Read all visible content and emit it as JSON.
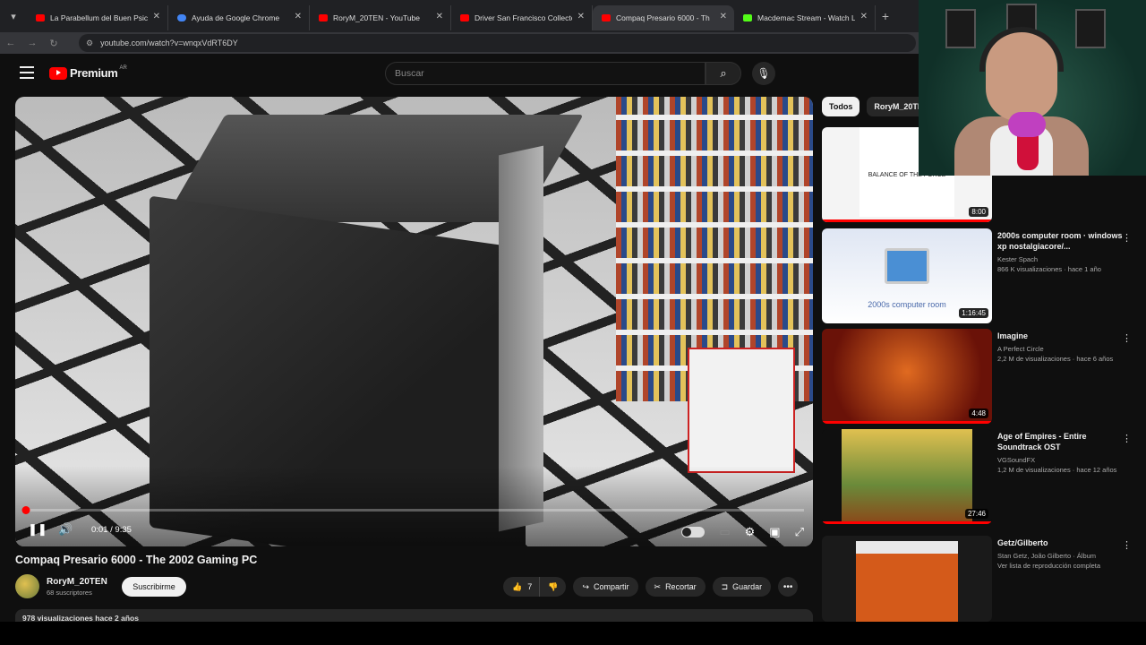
{
  "browser": {
    "tabs": [
      {
        "title": "La Parabellum del Buen Psicóp",
        "favicon_color": "#ff0000",
        "active": false
      },
      {
        "title": "Ayuda de Google Chrome",
        "favicon_color": "#4285f4",
        "active": false
      },
      {
        "title": "RoryM_20TEN - YouTube",
        "favicon_color": "#ff0000",
        "active": false
      },
      {
        "title": "Driver San Francisco Collector",
        "favicon_color": "#ff0000",
        "active": false
      },
      {
        "title": "Compaq Presario 6000 - Th",
        "favicon_color": "#ff0000",
        "active": true
      },
      {
        "title": "Macdemac Stream - Watch Live",
        "favicon_color": "#53fc18",
        "active": false
      }
    ],
    "url": "youtube.com/watch?v=wnqxVdRT6DY"
  },
  "header": {
    "logo_text": "Premium",
    "region": "AR",
    "search_placeholder": "Buscar"
  },
  "player": {
    "time": "0:01 / 9:35",
    "progress_fraction": 0.002
  },
  "video": {
    "title": "Compaq Presario 6000 - The 2002 Gaming PC",
    "channel": "RoryM_20TEN",
    "subscribers": "68 suscriptores",
    "subscribe_label": "Suscribirme",
    "likes": "7",
    "share_label": "Compartir",
    "clip_label": "Recortar",
    "save_label": "Guardar",
    "description_preview": "978 visualizaciones  hace 2 años"
  },
  "sidebar": {
    "chips": [
      "Todos",
      "RoryM_20TE"
    ],
    "items": [
      {
        "title": "",
        "channel": "",
        "meta": "",
        "meta2": "",
        "duration": "8:00",
        "thumb_color": "#f4f4f4"
      },
      {
        "title": "2000s computer room · windows xp nostalgiacore/...",
        "channel": "Kester Spach",
        "meta": "866 K visualizaciones · hace 1 año",
        "meta2": "",
        "duration": "1:16:45",
        "thumb_color": "#e9eef8"
      },
      {
        "title": "Imagine",
        "channel": "A Perfect Circle",
        "meta": "2,2 M de visualizaciones · hace 6 años",
        "meta2": "",
        "duration": "4:48",
        "thumb_color": "#7a1a10"
      },
      {
        "title": "Age of Empires - Entire Soundtrack OST",
        "channel": "VGSoundFX",
        "meta": "1,2 M de visualizaciones · hace 12 años",
        "meta2": "",
        "duration": "27:46",
        "thumb_color": "#c9a53a"
      },
      {
        "title": "Getz/Gilberto",
        "channel": "Stan Getz, João Gilberto · Álbum",
        "meta": "Ver lista de reproducción completa",
        "meta2": "",
        "duration": "",
        "thumb_color": "#d45a1a"
      }
    ]
  }
}
